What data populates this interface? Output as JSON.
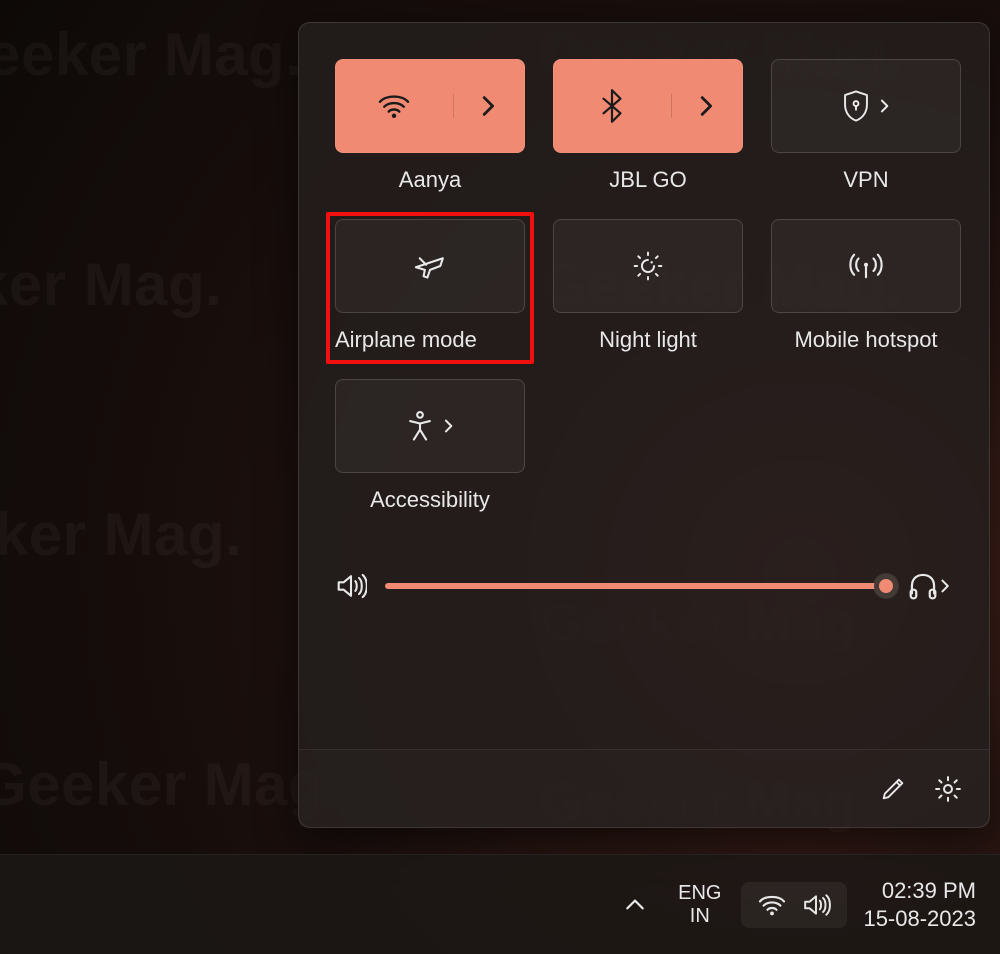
{
  "colors": {
    "accent": "#f08a73"
  },
  "watermark": "Geeker Mag.",
  "quick_settings": {
    "tiles": {
      "wifi": {
        "label": "Aanya",
        "active": true,
        "icon": "wifi-icon",
        "has_arrow": true
      },
      "bluetooth": {
        "label": "JBL GO",
        "active": true,
        "icon": "bluetooth-icon",
        "has_arrow": true
      },
      "vpn": {
        "label": "VPN",
        "active": false,
        "icon": "shield-lock-icon",
        "has_arrow": true,
        "compact_arrow": true
      },
      "airplane": {
        "label": "Airplane mode",
        "active": false,
        "icon": "airplane-icon",
        "has_arrow": false,
        "highlighted": true
      },
      "nightlight": {
        "label": "Night light",
        "active": false,
        "icon": "night-light-icon",
        "has_arrow": false
      },
      "hotspot": {
        "label": "Mobile hotspot",
        "active": false,
        "icon": "hotspot-icon",
        "has_arrow": false
      },
      "accessibility": {
        "label": "Accessibility",
        "active": false,
        "icon": "accessibility-icon",
        "has_arrow": true,
        "compact_arrow": true
      }
    },
    "volume": {
      "value": 100
    }
  },
  "taskbar": {
    "language": {
      "line1": "ENG",
      "line2": "IN"
    },
    "clock": {
      "time": "02:39 PM",
      "date": "15-08-2023"
    }
  }
}
